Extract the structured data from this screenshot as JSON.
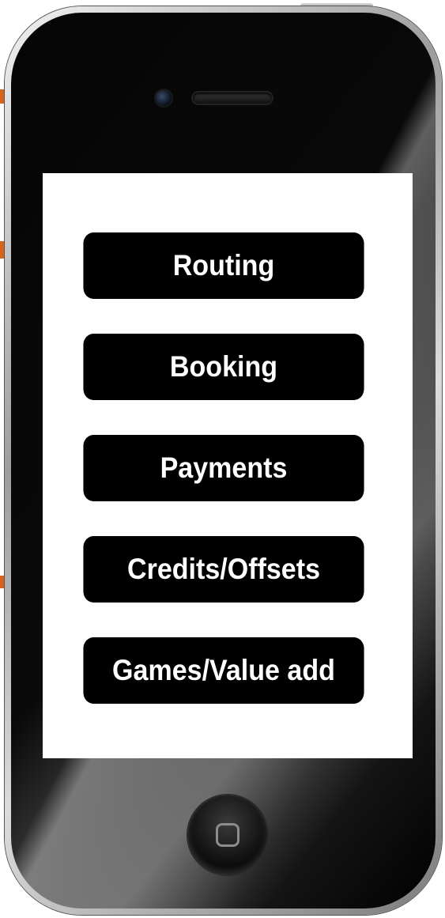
{
  "menu": {
    "items": [
      {
        "label": "Routing"
      },
      {
        "label": "Booking"
      },
      {
        "label": "Payments"
      },
      {
        "label": "Credits/Offsets"
      },
      {
        "label": "Games/Value add"
      }
    ]
  },
  "device": {
    "home_button_icon": "home-square-icon",
    "accent_color": "#d9621c"
  }
}
